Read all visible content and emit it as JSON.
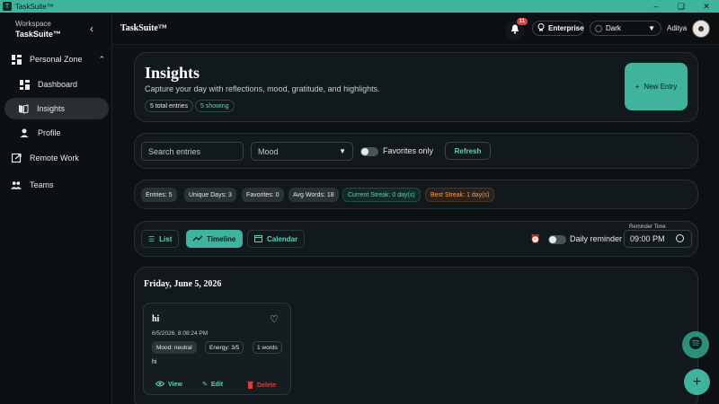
{
  "window": {
    "title": "TaskSuite™"
  },
  "sidebar": {
    "workspace_label": "Workspace",
    "workspace_name": "TaskSuite™",
    "items": [
      {
        "label": "Personal Zone"
      },
      {
        "label": "Dashboard"
      },
      {
        "label": "Insights"
      },
      {
        "label": "Profile"
      },
      {
        "label": "Remote Work"
      },
      {
        "label": "Teams"
      }
    ]
  },
  "header": {
    "brand": "TaskSuite™",
    "notif_count": "11",
    "plan": "Enterprise",
    "theme": "Dark",
    "user": "Aditya"
  },
  "hero": {
    "title": "Insights",
    "subtitle": "Capture your day with reflections, mood, gratitude, and highlights.",
    "total": "5 total entries",
    "showing": "5 showing",
    "new_entry": "New Entry"
  },
  "filters": {
    "search_placeholder": "Search entries",
    "mood": "Mood",
    "favorites": "Favorites only",
    "refresh": "Refresh"
  },
  "stats": {
    "entries": "Entries: 5",
    "unique_days": "Unique Days: 3",
    "favorites": "Favorites: 0",
    "avg_words": "Avg Words: 18",
    "current_streak": "Current Streak: 0 day(s)",
    "best_streak": "Best Streak: 1 day(s)"
  },
  "views": {
    "list": "List",
    "timeline": "Timeline",
    "calendar": "Calendar",
    "daily_reminder": "Daily reminder",
    "reminder_label": "Reminder Time",
    "reminder_value": "09:00 PM"
  },
  "timeline": {
    "date": "Friday, June 5, 2026",
    "entry": {
      "title": "hi",
      "timestamp": "6/5/2026, 8:08:24 PM",
      "mood": "Mood: neutral",
      "energy": "Energy: 3/5",
      "words": "1 words",
      "body": "hi",
      "view": "View",
      "edit": "Edit",
      "delete": "Delete"
    }
  },
  "colors": {
    "accent": "#3fb39c",
    "background": "#0d1114",
    "panel": "#12191c",
    "danger": "#e23b3b",
    "streak_best": "#f0a05a"
  }
}
